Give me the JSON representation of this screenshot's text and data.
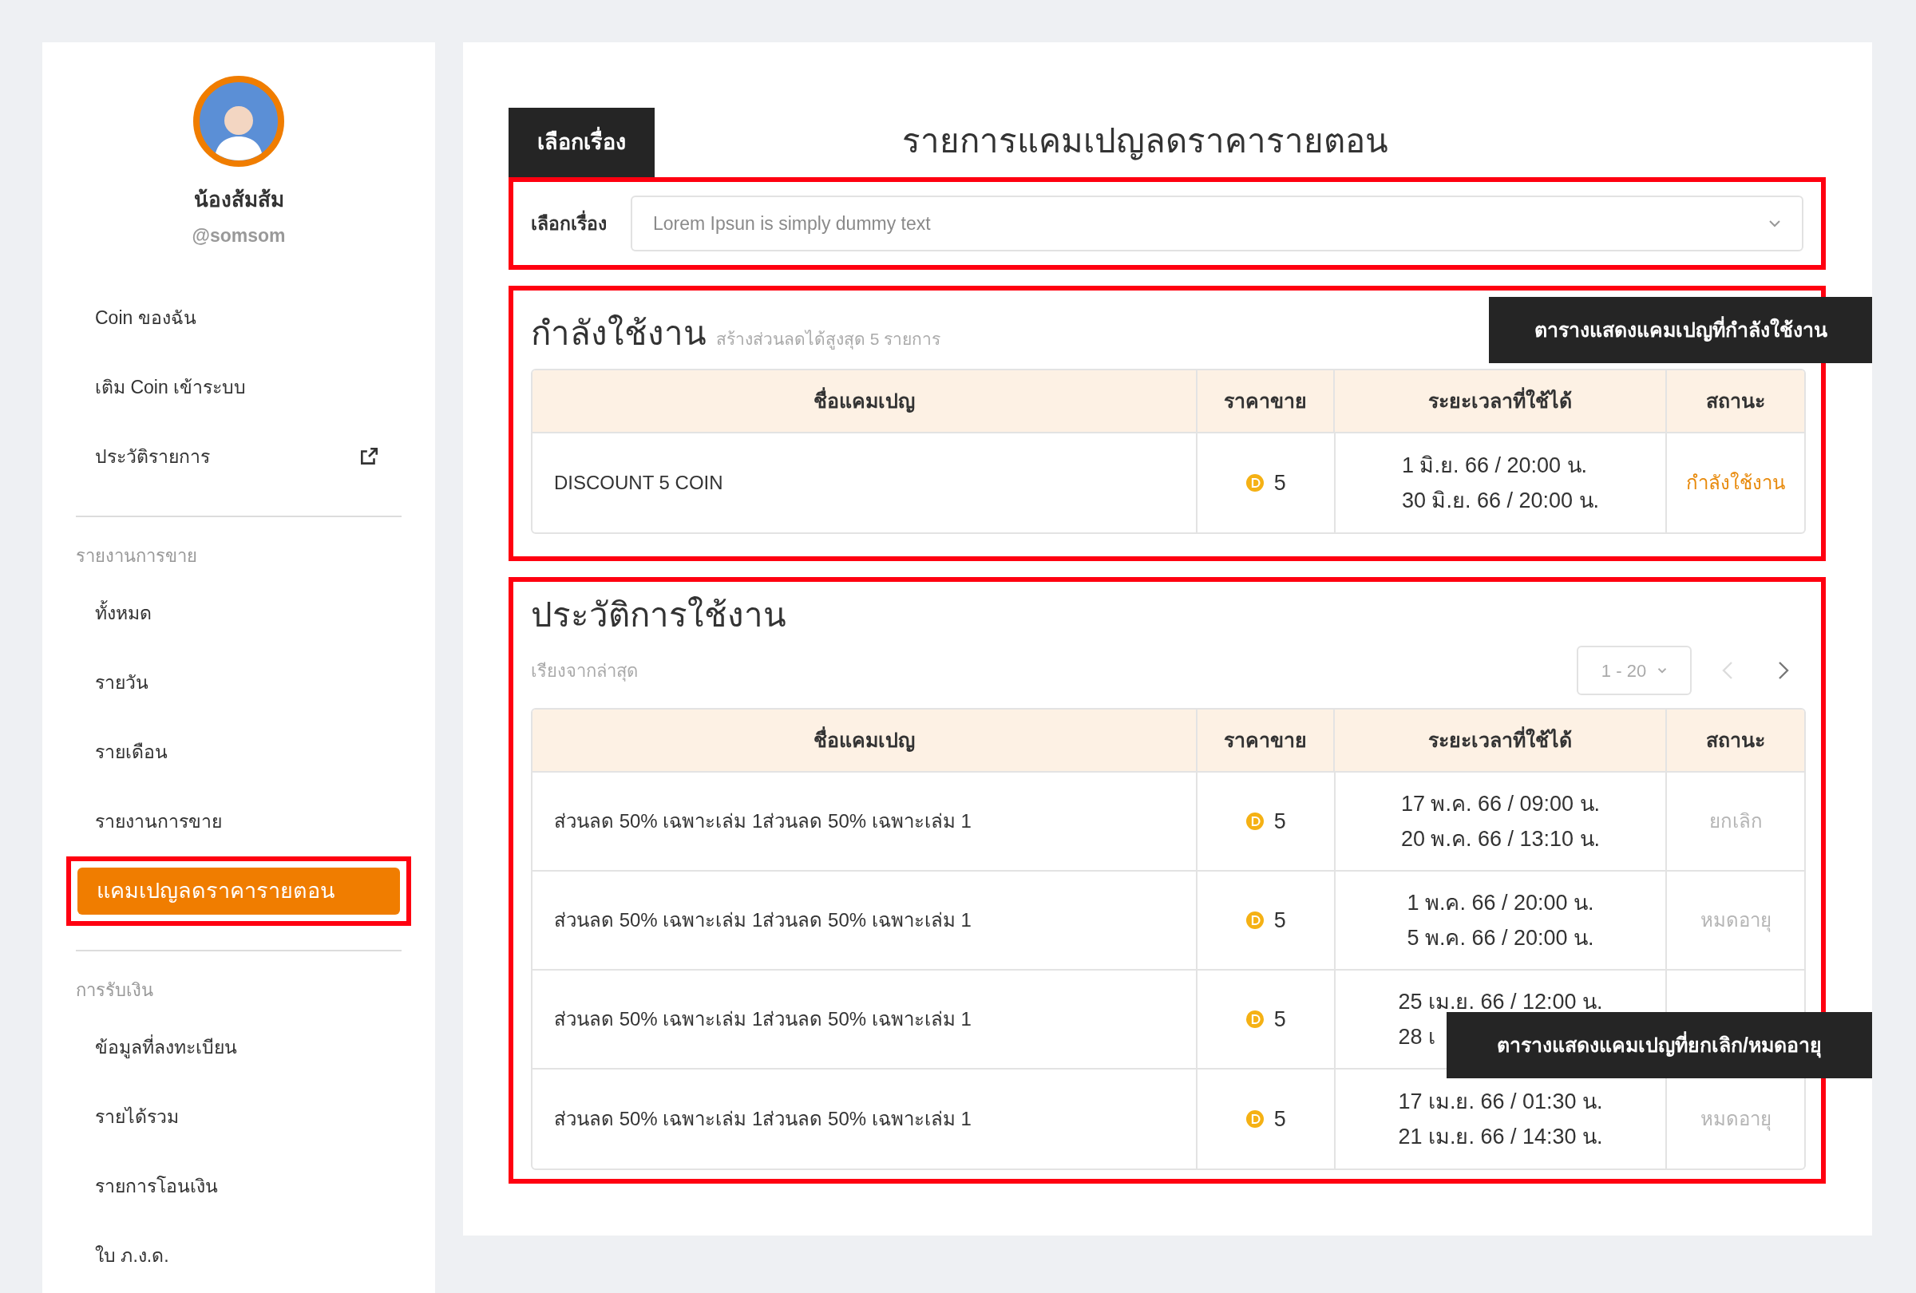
{
  "sidebar": {
    "profile": {
      "name": "น้องส้มส้ม",
      "handle": "@somsom"
    },
    "sections": [
      {
        "items": [
          {
            "label": "Coin ของฉัน",
            "selected": false,
            "external": false
          },
          {
            "label": "เติม Coin เข้าระบบ",
            "selected": false,
            "external": false
          },
          {
            "label": "ประวัติรายการ",
            "selected": false,
            "external": true
          }
        ]
      },
      {
        "heading": "รายงานการขาย",
        "items": [
          {
            "label": "ทั้งหมด",
            "selected": false
          },
          {
            "label": "รายวัน",
            "selected": false
          },
          {
            "label": "รายเดือน",
            "selected": false
          },
          {
            "label": "รายงานการขาย",
            "selected": false
          },
          {
            "label": "แคมเปญลดราคารายตอน",
            "selected": true
          }
        ]
      },
      {
        "heading": "การรับเงิน",
        "items": [
          {
            "label": "ข้อมูลที่ลงทะเบียน",
            "selected": false
          },
          {
            "label": "รายได้รวม",
            "selected": false
          },
          {
            "label": "รายการโอนเงิน",
            "selected": false
          },
          {
            "label": "ใบ ภ.ง.ด.",
            "selected": false
          }
        ]
      }
    ]
  },
  "page": {
    "tab_label": "เลือกเรื่อง",
    "title": "รายการแคมเปญลดราคารายตอน"
  },
  "story_select": {
    "label": "เลือกเรื่อง",
    "placeholder": "Lorem Ipsun is simply dummy text"
  },
  "active": {
    "title": "กำลังใช้งาน",
    "subtitle": "สร้างส่วนลดได้สูงสุด 5 รายการ",
    "columns": [
      "ชื่อแคมเปญ",
      "ราคาขาย",
      "ระยะเวลาที่ใช้ได้",
      "สถานะ"
    ],
    "rows": [
      {
        "name": "DISCOUNT 5 COIN",
        "price": "5",
        "dates": [
          "1 มิ.ย. 66 / 20:00 น.",
          "30 มิ.ย. 66 / 20:00 น."
        ],
        "status": "กำลังใช้งาน",
        "active": true
      }
    ]
  },
  "history": {
    "title": "ประวัติการใช้งาน",
    "sort_label": "เรียงจากล่าสุด",
    "page_size": "1 - 20",
    "prev_disabled": true,
    "columns": [
      "ชื่อแคมเปญ",
      "ราคาขาย",
      "ระยะเวลาที่ใช้ได้",
      "สถานะ"
    ],
    "rows": [
      {
        "name": "ส่วนลด 50% เฉพาะเล่ม 1ส่วนลด 50% เฉพาะเล่ม 1",
        "price": "5",
        "dates": [
          "17 พ.ค. 66 / 09:00 น.",
          "20 พ.ค. 66 / 13:10 น."
        ],
        "status": "ยกเลิก",
        "active": false
      },
      {
        "name": "ส่วนลด 50% เฉพาะเล่ม 1ส่วนลด 50% เฉพาะเล่ม 1",
        "price": "5",
        "dates": [
          "1 พ.ค. 66 / 20:00 น.",
          "5 พ.ค. 66 / 20:00 น."
        ],
        "status": "หมดอายุ",
        "active": false
      },
      {
        "name": "ส่วนลด 50% เฉพาะเล่ม 1ส่วนลด 50% เฉพาะเล่ม 1",
        "price": "5",
        "dates": [
          "25 เม.ย. 66 / 12:00 น.",
          "28 เ"
        ]
      },
      {
        "name": "ส่วนลด 50% เฉพาะเล่ม 1ส่วนลด 50% เฉพาะเล่ม 1",
        "price": "5",
        "dates": [
          "17 เม.ย. 66 / 01:30 น.",
          "21 เม.ย. 66 / 14:30 น."
        ],
        "status": "หมดอายุ",
        "active": false
      }
    ]
  },
  "annotations": [
    {
      "text": "ตารางแสดงแคมเปญที่กำลังใช้งาน"
    },
    {
      "text": "ตารางแสดงแคมเปญที่ยกเลิก/หมดอายุ"
    }
  ]
}
